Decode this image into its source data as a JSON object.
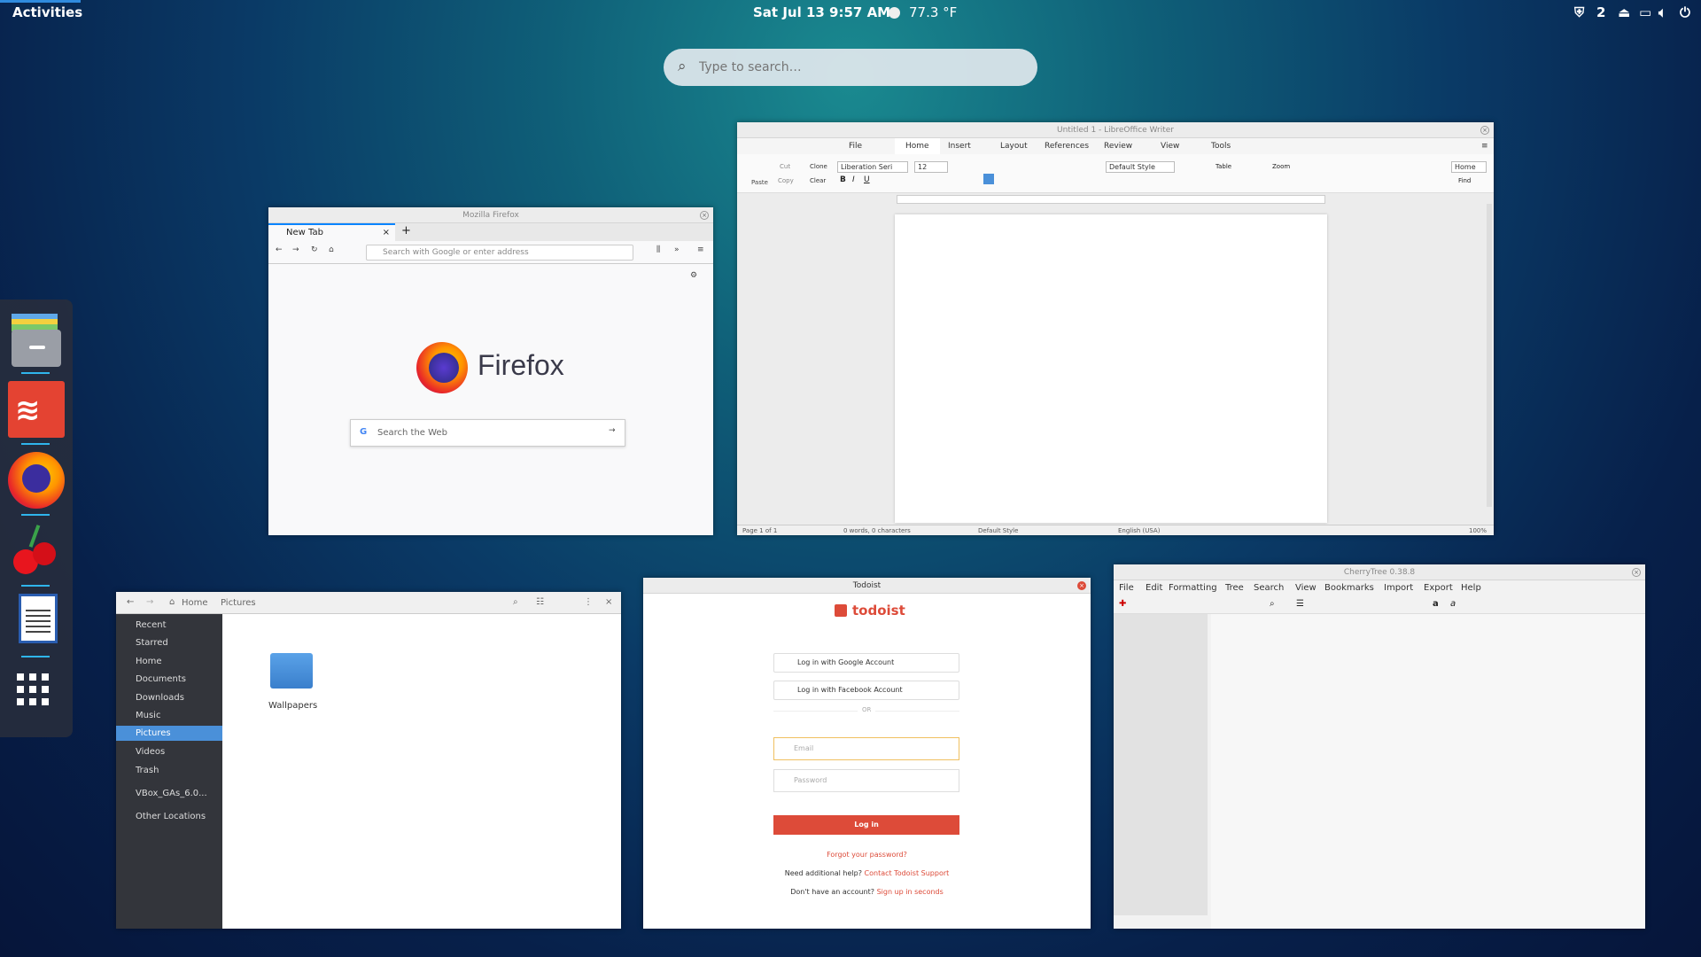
{
  "topbar": {
    "activities": "Activities",
    "clock": "Sat Jul 13   9:57 AM",
    "weather": "77.3 °F",
    "workspace_count": "2"
  },
  "search": {
    "placeholder": "Type to search…"
  },
  "dock": {
    "apps": [
      "files",
      "todoist",
      "firefox",
      "cherrytree",
      "libreoffice-writer",
      "show-apps"
    ]
  },
  "firefox": {
    "title": "Mozilla Firefox",
    "tab": "New Tab",
    "url_placeholder": "Search with Google or enter address",
    "brand": "Firefox",
    "search_placeholder": "Search the Web"
  },
  "writer": {
    "title": "Untitled 1 - LibreOffice Writer",
    "menu": [
      "File",
      "Home",
      "Insert",
      "Layout",
      "References",
      "Review",
      "View",
      "Tools"
    ],
    "clipboard": {
      "paste": "Paste",
      "cut": "Cut",
      "copy": "Copy",
      "clone": "Clone",
      "clear": "Clear"
    },
    "font": "Liberation Seri",
    "size": "12",
    "para_style": "Default Style",
    "table": "Table",
    "zoom_label": "Zoom",
    "home": "Home",
    "find": "Find",
    "status": {
      "page": "Page 1 of 1",
      "words": "0 words, 0 characters",
      "style": "Default Style",
      "lang": "English (USA)",
      "zoom": "100%"
    }
  },
  "files": {
    "crumbs": [
      "Home",
      "Pictures"
    ],
    "sidebar": [
      "Recent",
      "Starred",
      "Home",
      "Documents",
      "Downloads",
      "Music",
      "Pictures",
      "Videos",
      "Trash",
      "VBox_GAs_6.0...",
      "Other Locations"
    ],
    "folder": "Wallpapers"
  },
  "todoist": {
    "title": "Todoist",
    "brand": "todoist",
    "google": "Log in with Google Account",
    "facebook": "Log in with Facebook Account",
    "or": "OR",
    "email": "Email",
    "password": "Password",
    "login": "Log in",
    "forgot": "Forgot your password?",
    "help": "Need additional help?",
    "help_link": "Contact Todoist Support",
    "signup_q": "Don't have an account?",
    "signup_link": "Sign up in seconds"
  },
  "cherrytree": {
    "title": "CherryTree 0.38.8",
    "menu": [
      "File",
      "Edit",
      "Formatting",
      "Tree",
      "Search",
      "View",
      "Bookmarks",
      "Import",
      "Export",
      "Help"
    ]
  },
  "colors": {
    "accent": "#2fb5ec",
    "todoist_red": "#dd4b39",
    "selection": "#4a90d9"
  }
}
